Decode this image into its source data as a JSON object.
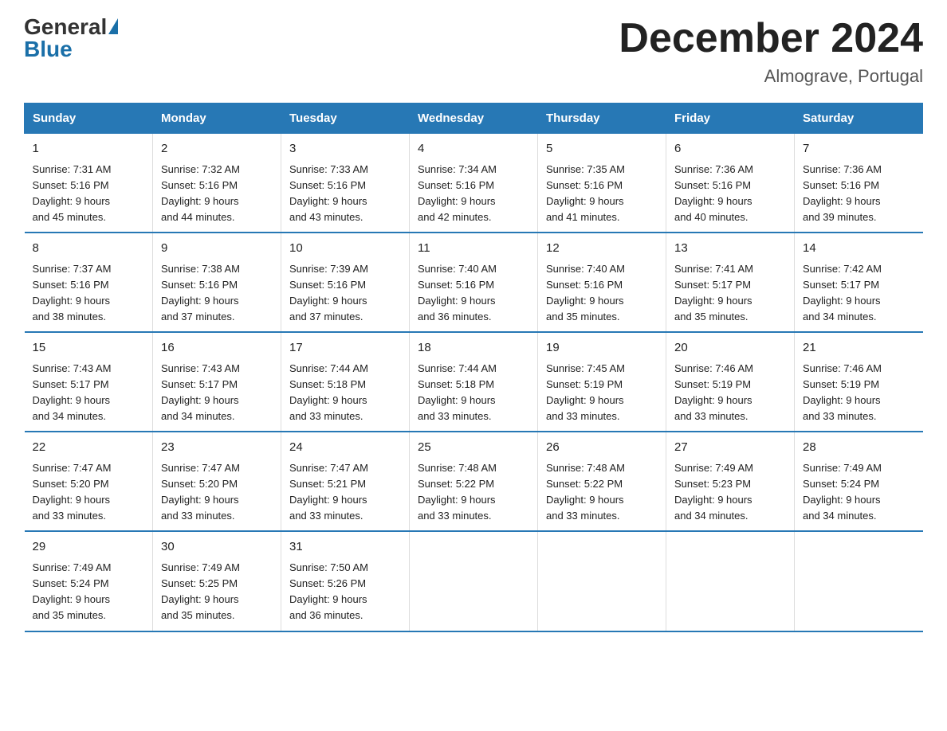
{
  "logo": {
    "general": "General",
    "triangle": "▲",
    "blue": "Blue"
  },
  "title": "December 2024",
  "subtitle": "Almograve, Portugal",
  "days_of_week": [
    "Sunday",
    "Monday",
    "Tuesday",
    "Wednesday",
    "Thursday",
    "Friday",
    "Saturday"
  ],
  "weeks": [
    [
      {
        "day": "1",
        "info": "Sunrise: 7:31 AM\nSunset: 5:16 PM\nDaylight: 9 hours\nand 45 minutes."
      },
      {
        "day": "2",
        "info": "Sunrise: 7:32 AM\nSunset: 5:16 PM\nDaylight: 9 hours\nand 44 minutes."
      },
      {
        "day": "3",
        "info": "Sunrise: 7:33 AM\nSunset: 5:16 PM\nDaylight: 9 hours\nand 43 minutes."
      },
      {
        "day": "4",
        "info": "Sunrise: 7:34 AM\nSunset: 5:16 PM\nDaylight: 9 hours\nand 42 minutes."
      },
      {
        "day": "5",
        "info": "Sunrise: 7:35 AM\nSunset: 5:16 PM\nDaylight: 9 hours\nand 41 minutes."
      },
      {
        "day": "6",
        "info": "Sunrise: 7:36 AM\nSunset: 5:16 PM\nDaylight: 9 hours\nand 40 minutes."
      },
      {
        "day": "7",
        "info": "Sunrise: 7:36 AM\nSunset: 5:16 PM\nDaylight: 9 hours\nand 39 minutes."
      }
    ],
    [
      {
        "day": "8",
        "info": "Sunrise: 7:37 AM\nSunset: 5:16 PM\nDaylight: 9 hours\nand 38 minutes."
      },
      {
        "day": "9",
        "info": "Sunrise: 7:38 AM\nSunset: 5:16 PM\nDaylight: 9 hours\nand 37 minutes."
      },
      {
        "day": "10",
        "info": "Sunrise: 7:39 AM\nSunset: 5:16 PM\nDaylight: 9 hours\nand 37 minutes."
      },
      {
        "day": "11",
        "info": "Sunrise: 7:40 AM\nSunset: 5:16 PM\nDaylight: 9 hours\nand 36 minutes."
      },
      {
        "day": "12",
        "info": "Sunrise: 7:40 AM\nSunset: 5:16 PM\nDaylight: 9 hours\nand 35 minutes."
      },
      {
        "day": "13",
        "info": "Sunrise: 7:41 AM\nSunset: 5:17 PM\nDaylight: 9 hours\nand 35 minutes."
      },
      {
        "day": "14",
        "info": "Sunrise: 7:42 AM\nSunset: 5:17 PM\nDaylight: 9 hours\nand 34 minutes."
      }
    ],
    [
      {
        "day": "15",
        "info": "Sunrise: 7:43 AM\nSunset: 5:17 PM\nDaylight: 9 hours\nand 34 minutes."
      },
      {
        "day": "16",
        "info": "Sunrise: 7:43 AM\nSunset: 5:17 PM\nDaylight: 9 hours\nand 34 minutes."
      },
      {
        "day": "17",
        "info": "Sunrise: 7:44 AM\nSunset: 5:18 PM\nDaylight: 9 hours\nand 33 minutes."
      },
      {
        "day": "18",
        "info": "Sunrise: 7:44 AM\nSunset: 5:18 PM\nDaylight: 9 hours\nand 33 minutes."
      },
      {
        "day": "19",
        "info": "Sunrise: 7:45 AM\nSunset: 5:19 PM\nDaylight: 9 hours\nand 33 minutes."
      },
      {
        "day": "20",
        "info": "Sunrise: 7:46 AM\nSunset: 5:19 PM\nDaylight: 9 hours\nand 33 minutes."
      },
      {
        "day": "21",
        "info": "Sunrise: 7:46 AM\nSunset: 5:19 PM\nDaylight: 9 hours\nand 33 minutes."
      }
    ],
    [
      {
        "day": "22",
        "info": "Sunrise: 7:47 AM\nSunset: 5:20 PM\nDaylight: 9 hours\nand 33 minutes."
      },
      {
        "day": "23",
        "info": "Sunrise: 7:47 AM\nSunset: 5:20 PM\nDaylight: 9 hours\nand 33 minutes."
      },
      {
        "day": "24",
        "info": "Sunrise: 7:47 AM\nSunset: 5:21 PM\nDaylight: 9 hours\nand 33 minutes."
      },
      {
        "day": "25",
        "info": "Sunrise: 7:48 AM\nSunset: 5:22 PM\nDaylight: 9 hours\nand 33 minutes."
      },
      {
        "day": "26",
        "info": "Sunrise: 7:48 AM\nSunset: 5:22 PM\nDaylight: 9 hours\nand 33 minutes."
      },
      {
        "day": "27",
        "info": "Sunrise: 7:49 AM\nSunset: 5:23 PM\nDaylight: 9 hours\nand 34 minutes."
      },
      {
        "day": "28",
        "info": "Sunrise: 7:49 AM\nSunset: 5:24 PM\nDaylight: 9 hours\nand 34 minutes."
      }
    ],
    [
      {
        "day": "29",
        "info": "Sunrise: 7:49 AM\nSunset: 5:24 PM\nDaylight: 9 hours\nand 35 minutes."
      },
      {
        "day": "30",
        "info": "Sunrise: 7:49 AM\nSunset: 5:25 PM\nDaylight: 9 hours\nand 35 minutes."
      },
      {
        "day": "31",
        "info": "Sunrise: 7:50 AM\nSunset: 5:26 PM\nDaylight: 9 hours\nand 36 minutes."
      },
      {
        "day": "",
        "info": ""
      },
      {
        "day": "",
        "info": ""
      },
      {
        "day": "",
        "info": ""
      },
      {
        "day": "",
        "info": ""
      }
    ]
  ]
}
